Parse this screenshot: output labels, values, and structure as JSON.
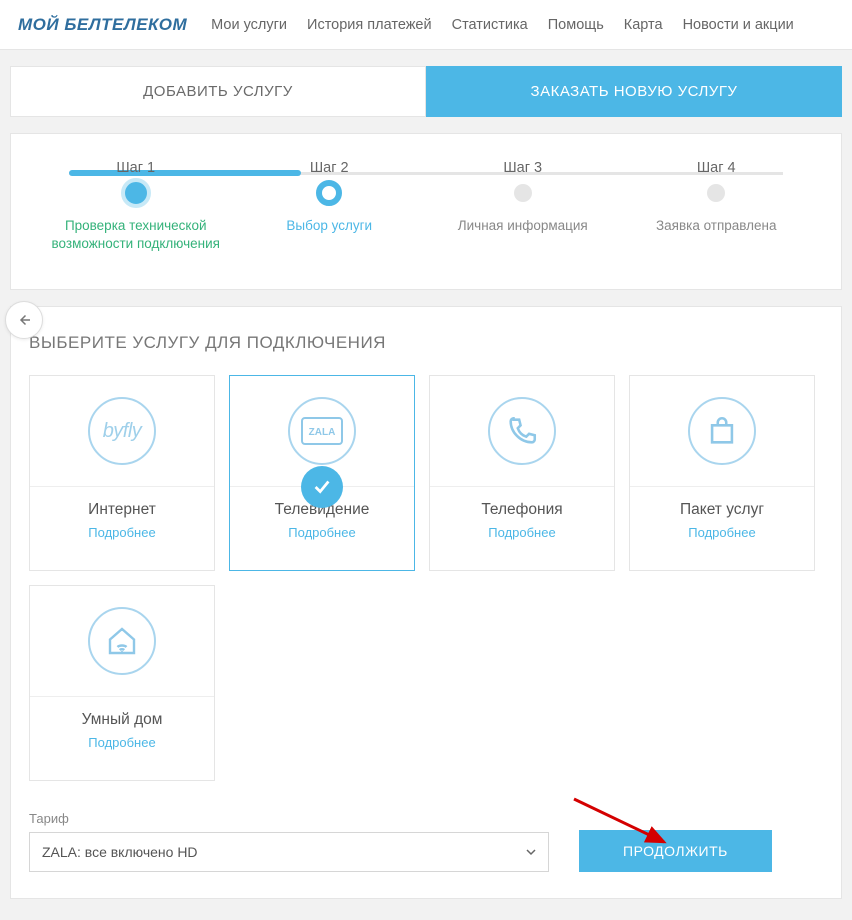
{
  "header": {
    "logo": "МОЙ БЕЛТЕЛЕКОМ",
    "nav": [
      "Мои услуги",
      "История платежей",
      "Статистика",
      "Помощь",
      "Карта",
      "Новости и акции"
    ]
  },
  "tabs": {
    "add": "ДОБАВИТЬ УСЛУГУ",
    "order": "ЗАКАЗАТЬ НОВУЮ УСЛУГУ"
  },
  "steps": [
    {
      "top": "Шаг 1",
      "label": "Проверка технической возможности подключения"
    },
    {
      "top": "Шаг 2",
      "label": "Выбор услуги"
    },
    {
      "top": "Шаг 3",
      "label": "Личная информация"
    },
    {
      "top": "Шаг 4",
      "label": "Заявка отправлена"
    }
  ],
  "section_title": "ВЫБЕРИТЕ УСЛУГУ ДЛЯ ПОДКЛЮЧЕНИЯ",
  "cards": [
    {
      "title": "Интернет",
      "more": "Подробнее"
    },
    {
      "title": "Телевидение",
      "more": "Подробнее"
    },
    {
      "title": "Телефония",
      "more": "Подробнее"
    },
    {
      "title": "Пакет услуг",
      "more": "Подробнее"
    },
    {
      "title": "Умный дом",
      "more": "Подробнее"
    }
  ],
  "tariff": {
    "label": "Тариф",
    "selected": "ZALA: все включено HD"
  },
  "continue_label": "ПРОДОЛЖИТЬ",
  "icons": {
    "byfly": "byfly",
    "zala": "ZALA"
  }
}
